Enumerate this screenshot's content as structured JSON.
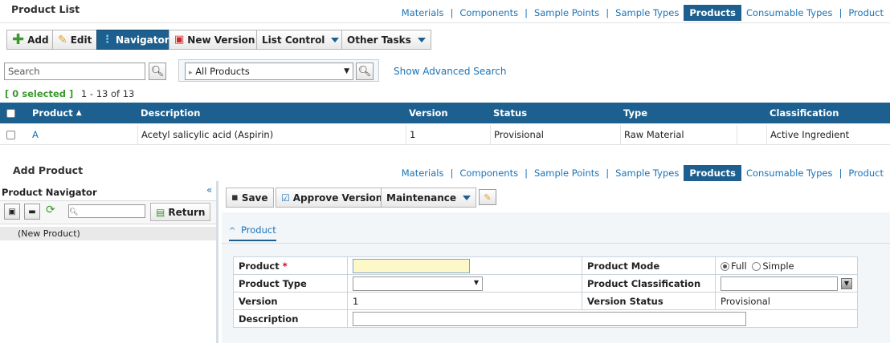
{
  "top": {
    "title": "Product List",
    "nav": [
      "Materials",
      "|",
      "Components",
      "|",
      "Sample Points",
      "|",
      "Sample Types",
      "Products",
      "Consumable Types",
      "|",
      "Product"
    ],
    "active_nav": "Products"
  },
  "toolbar": {
    "add": "Add",
    "edit": "Edit",
    "navigator": "Navigator",
    "new_version": "New Version",
    "list_control": "List Control",
    "other_tasks": "Other Tasks"
  },
  "search": {
    "placeholder": "Search",
    "filter": "All Products",
    "advanced": "Show Advanced Search"
  },
  "selection": {
    "selected": "[ 0 selected ]",
    "range": "1 - 13 of 13"
  },
  "table": {
    "headers": [
      "Product",
      "Description",
      "Version",
      "Status",
      "Type",
      "Classification"
    ],
    "rows": [
      [
        "A",
        "Acetyl salicylic acid (Aspirin)",
        "1",
        "Provisional",
        "Raw Material",
        "Active Ingredient"
      ]
    ]
  },
  "bottom": {
    "title": "Add Product",
    "nav": [
      "Materials",
      "|",
      "Components",
      "|",
      "Sample Points",
      "|",
      "Sample Types",
      "Products",
      "Consumable Types",
      "|",
      "Product"
    ],
    "active_nav": "Products"
  },
  "navigator": {
    "title": "Product Navigator",
    "collapse": "«",
    "return": "Return",
    "item": "(New Product)"
  },
  "form_toolbar": {
    "save": "Save",
    "approve": "Approve Version",
    "maintenance": "Maintenance"
  },
  "section": {
    "toggle": "^",
    "title": "Product"
  },
  "form": {
    "product_label": "Product",
    "required": "*",
    "product_mode_label": "Product Mode",
    "mode_full": "Full",
    "mode_simple": "Simple",
    "product_type_label": "Product Type",
    "classification_label": "Product Classification",
    "version_label": "Version",
    "version_value": "1",
    "version_status_label": "Version Status",
    "version_status_value": "Provisional",
    "description_label": "Description"
  },
  "colors": {
    "header_blue": "#1d5f8e",
    "link_blue": "#1a73b8",
    "required_red": "#d0021b",
    "selected_green": "#3a9a2c"
  }
}
